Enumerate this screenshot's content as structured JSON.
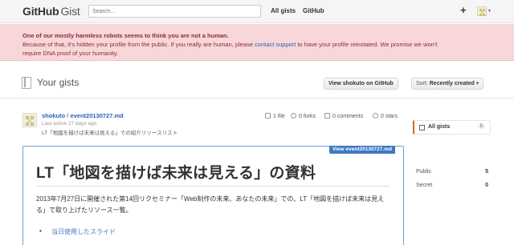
{
  "header": {
    "logo_main": "GitHub",
    "logo_sub": "Gist",
    "search_placeholder": "Search...",
    "nav": [
      "All gists",
      "GitHub"
    ],
    "plus": "+",
    "caret": "▾"
  },
  "alert": {
    "title": "One of our mostly harmless robots seems to think you are not a human.",
    "line1_before": "Because of that, it's hidden your profile from the public. If you really are human, please ",
    "link": "contact support",
    "line1_after": " to have your profile reinstated. We promise we won't",
    "line2": "require DNA proof of your humanity."
  },
  "pagehead": {
    "title": "Your gists",
    "view_button": "View shokuto on GitHub",
    "sort_label": "Sort:",
    "sort_value": "Recently created",
    "sort_caret": "▾"
  },
  "gist": {
    "owner": "shokuto",
    "separator": " / ",
    "filename": "event20130727.md",
    "meta": "Last active 27 days ago",
    "description": "LT「地図を描けば未来は見える」での紹介リソースリスト",
    "stats": [
      "1 file",
      "0 forks",
      "0 comments",
      "0 stars"
    ],
    "view_tab": "View event20130727.md"
  },
  "markdown": {
    "h1": "LT「地図を描けば未来は見える」の資料",
    "paragraph": "2013年7月27日に開催された第14回リクセミナー「Web制作の未来、あなたの未来」での、LT「地図を描けば未来は見える」で取り上げたリソース一覧。",
    "list_item": "当日使用したスライド"
  },
  "sidebar": {
    "all_label": "All gists",
    "all_count": "5",
    "rows": [
      {
        "label": "Public",
        "count": "5"
      },
      {
        "label": "Secret",
        "count": "0"
      }
    ]
  },
  "colors": {
    "alert_bg": "#f8d7da",
    "alert_text": "#8f2a33",
    "link": "#2962b6",
    "accent": "#d26911"
  }
}
